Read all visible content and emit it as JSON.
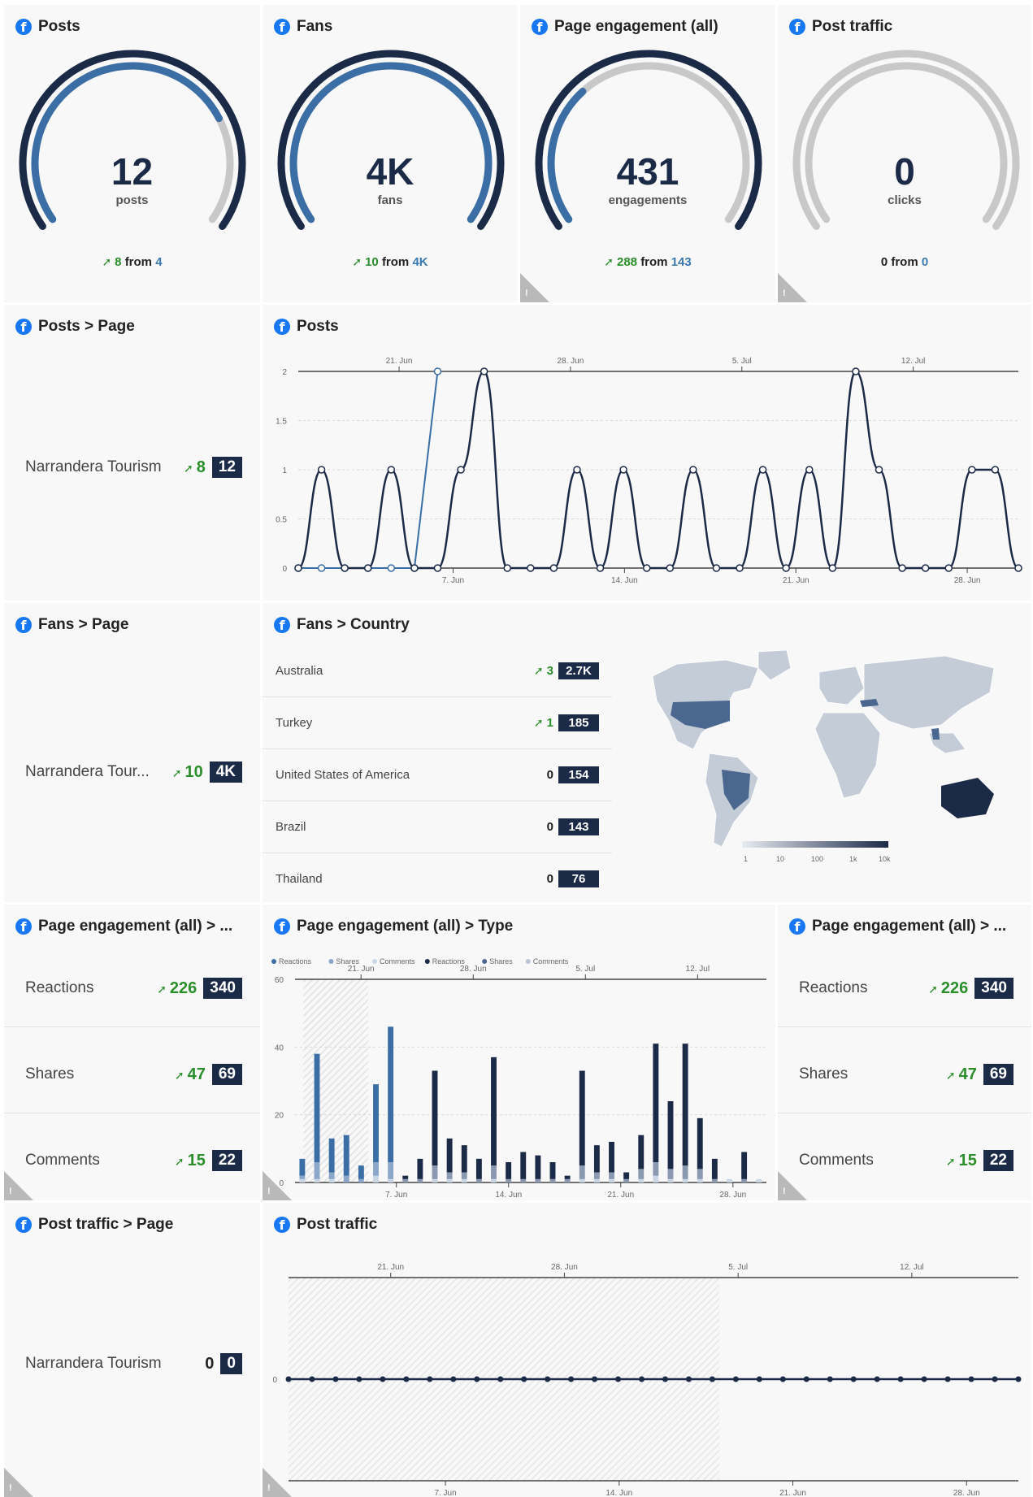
{
  "gauges": [
    {
      "title": "Posts",
      "value": "12",
      "unit": "posts",
      "change": "8",
      "from_word": "from",
      "prev": "4",
      "arrow": true,
      "fraction": 0.75,
      "warning": false
    },
    {
      "title": "Fans",
      "value": "4K",
      "unit": "fans",
      "change": "10",
      "from_word": "from",
      "prev": "4K",
      "arrow": true,
      "fraction": 1.0,
      "warning": false
    },
    {
      "title": "Page engagement (all)",
      "value": "431",
      "unit": "engagements",
      "change": "288",
      "from_word": "from",
      "prev": "143",
      "arrow": true,
      "fraction": 0.33,
      "warning": true
    },
    {
      "title": "Post traffic",
      "value": "0",
      "unit": "clicks",
      "change": "0",
      "from_word": "from",
      "prev": "0",
      "arrow": false,
      "fraction": 0,
      "warning": true
    }
  ],
  "posts_page": {
    "title": "Posts > Page",
    "label": "Narrandera Tourism",
    "change": "8",
    "value": "12"
  },
  "posts_chart_title": "Posts",
  "fans_page": {
    "title": "Fans > Page",
    "label": "Narrandera Tour...",
    "change": "10",
    "value": "4K"
  },
  "fans_country": {
    "title": "Fans > Country",
    "rows": [
      {
        "label": "Australia",
        "change": "3",
        "arrow": true,
        "value": "2.7K"
      },
      {
        "label": "Turkey",
        "change": "1",
        "arrow": true,
        "value": "185"
      },
      {
        "label": "United States of America",
        "change": "0",
        "arrow": false,
        "value": "154"
      },
      {
        "label": "Brazil",
        "change": "0",
        "arrow": false,
        "value": "143"
      },
      {
        "label": "Thailand",
        "change": "0",
        "arrow": false,
        "value": "76"
      }
    ],
    "scale_labels": [
      "1",
      "10",
      "100",
      "1k",
      "10k"
    ]
  },
  "engagement_left": {
    "title": "Page engagement (all) > ...",
    "rows": [
      {
        "label": "Reactions",
        "change": "226",
        "value": "340"
      },
      {
        "label": "Shares",
        "change": "47",
        "value": "69"
      },
      {
        "label": "Comments",
        "change": "15",
        "value": "22"
      }
    ]
  },
  "engagement_type_title": "Page engagement (all) > Type",
  "engagement_right": {
    "title": "Page engagement (all) > ...",
    "rows": [
      {
        "label": "Reactions",
        "change": "226",
        "value": "340"
      },
      {
        "label": "Shares",
        "change": "47",
        "value": "69"
      },
      {
        "label": "Comments",
        "change": "15",
        "value": "22"
      }
    ]
  },
  "post_traffic_page": {
    "title": "Post traffic > Page",
    "label": "Narrandera Tourism",
    "change": "0",
    "value": "0"
  },
  "post_traffic_chart_title": "Post traffic",
  "colors": {
    "navy": "#1b2a47",
    "mid_blue": "#3a6ea5",
    "light_blue": "#a9c1dc",
    "grey_arc": "#c8c8c8",
    "green": "#2a8f2a"
  },
  "chart_data": [
    {
      "type": "line",
      "title": "Posts",
      "x_top_ticks": [
        "21. Jun",
        "28. Jun",
        "5. Jul",
        "12. Jul"
      ],
      "x_bottom_ticks": [
        "7. Jun",
        "14. Jun",
        "21. Jun",
        "28. Jun"
      ],
      "y_ticks": [
        "0",
        "0.5",
        "1",
        "1.5",
        "2"
      ],
      "ylim": [
        0,
        2
      ],
      "series": [
        {
          "values": [
            0,
            0,
            0,
            0,
            0,
            0,
            2
          ]
        },
        {
          "values": [
            0,
            1,
            0,
            0,
            1,
            0,
            0,
            1,
            2,
            0,
            0,
            0,
            1,
            0,
            1,
            0,
            0,
            1,
            0,
            0,
            1,
            0,
            1,
            0,
            2,
            1,
            0,
            0,
            0,
            1,
            1,
            0
          ]
        }
      ]
    },
    {
      "type": "bar",
      "title": "Page engagement (all) > Type",
      "legend": [
        "Reactions",
        "Shares",
        "Comments",
        "Reactions",
        "Shares",
        "Comments"
      ],
      "x_top_ticks": [
        "21. Jun",
        "28. Jun",
        "5. Jul",
        "12. Jul"
      ],
      "x_bottom_ticks": [
        "7. Jun",
        "14. Jun",
        "21. Jun",
        "28. Jun"
      ],
      "y_ticks": [
        "0",
        "20",
        "40",
        "60"
      ],
      "ylim": [
        0,
        60
      ],
      "series": [
        {
          "name": "Reactions",
          "values": [
            5,
            32,
            10,
            12,
            4,
            23,
            40,
            1,
            6,
            28,
            10,
            8,
            6,
            32,
            5,
            8,
            7,
            5,
            1,
            28,
            8,
            9,
            2,
            10,
            35,
            20,
            36,
            15,
            6,
            0,
            8,
            0
          ]
        },
        {
          "name": "Shares",
          "values": [
            1,
            5,
            2,
            2,
            1,
            4,
            5,
            1,
            1,
            4,
            2,
            2,
            1,
            4,
            1,
            1,
            1,
            1,
            1,
            4,
            2,
            2,
            1,
            3,
            4,
            3,
            4,
            3,
            1,
            0,
            1,
            0
          ]
        },
        {
          "name": "Comments",
          "values": [
            1,
            1,
            1,
            0,
            0,
            2,
            1,
            0,
            0,
            1,
            1,
            1,
            0,
            1,
            0,
            0,
            0,
            0,
            0,
            1,
            1,
            1,
            0,
            1,
            2,
            1,
            1,
            1,
            0,
            1,
            0,
            1
          ]
        }
      ]
    },
    {
      "type": "line",
      "title": "Post traffic",
      "x_top_ticks": [
        "21. Jun",
        "28. Jun",
        "5. Jul",
        "12. Jul"
      ],
      "x_bottom_ticks": [
        "7. Jun",
        "14. Jun",
        "21. Jun",
        "28. Jun"
      ],
      "y_ticks": [
        "0"
      ],
      "ylim": [
        -1,
        1
      ],
      "series": [
        {
          "values": [
            0,
            0,
            0,
            0,
            0,
            0,
            0,
            0,
            0,
            0,
            0,
            0,
            0,
            0,
            0,
            0,
            0,
            0,
            0,
            0,
            0,
            0,
            0,
            0,
            0,
            0,
            0,
            0,
            0,
            0,
            0,
            0
          ]
        }
      ]
    }
  ]
}
